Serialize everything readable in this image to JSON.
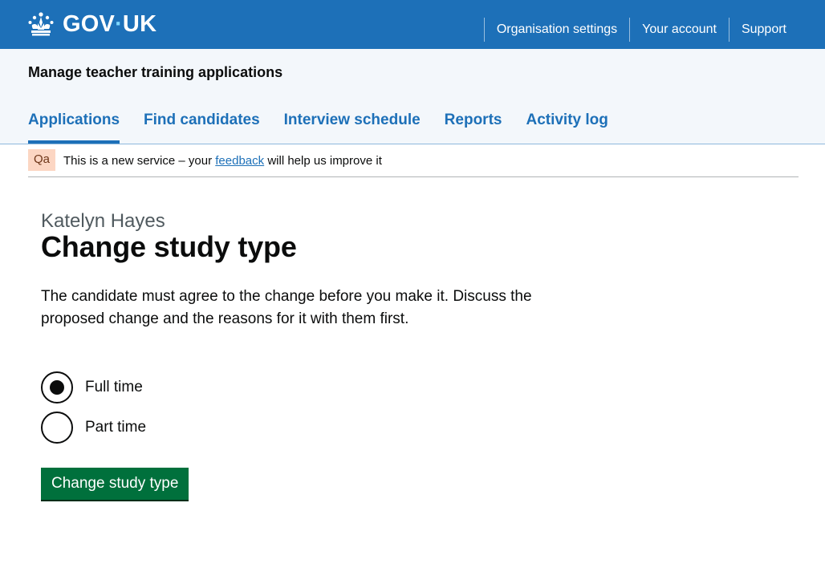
{
  "header": {
    "logo_text": "GOV",
    "logo_text_suffix": "UK",
    "nav": [
      {
        "label": "Organisation settings"
      },
      {
        "label": "Your account"
      },
      {
        "label": "Support"
      }
    ]
  },
  "service": {
    "name": "Manage teacher training applications",
    "nav": [
      {
        "label": "Applications",
        "active": true
      },
      {
        "label": "Find candidates"
      },
      {
        "label": "Interview schedule"
      },
      {
        "label": "Reports"
      },
      {
        "label": "Activity log"
      }
    ]
  },
  "phase_banner": {
    "tag": "Qa",
    "text_before": "This is a new service – your ",
    "link": "feedback",
    "text_after": " will help us improve it"
  },
  "main": {
    "caption": "Katelyn Hayes",
    "heading": "Change study type",
    "body": "The candidate must agree to the change before you make it. Discuss the proposed change and the reasons for it with them first.",
    "options": [
      {
        "label": "Full time",
        "checked": true
      },
      {
        "label": "Part time",
        "checked": false
      }
    ],
    "submit_label": "Change study type"
  },
  "colors": {
    "header_blue": "#1d70b8",
    "button_green": "#00703c",
    "tag_background": "#fcd6c3"
  }
}
